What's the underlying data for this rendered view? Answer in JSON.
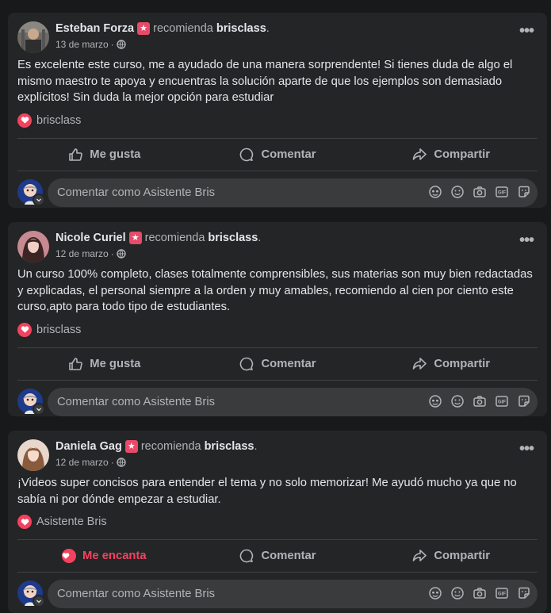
{
  "posts": [
    {
      "author": "Esteban Forza",
      "recommends": "recomienda",
      "page": "brisclass",
      "end": ".",
      "date": "13 de marzo",
      "sep": "·",
      "text": "Es excelente este curso, me a ayudado de una manera sorprendente! Si tienes duda de algo el mismo maestro te apoya y encuentras la solución aparte de que los ejemplos son demasiado explícitos! Sin duda la mejor opción para estudiar",
      "tag": "brisclass",
      "like_label": "Me gusta",
      "comment_label": "Comentar",
      "share_label": "Compartir",
      "comment_placeholder": "Comentar como Asistente Bris"
    },
    {
      "author": "Nicole Curiel",
      "recommends": "recomienda",
      "page": "brisclass",
      "end": ".",
      "date": "12 de marzo",
      "sep": "·",
      "text": "Un curso 100% completo, clases totalmente comprensibles, sus materias son muy bien redactadas y explicadas, el personal siempre a la orden y muy amables, recomiendo al cien por ciento este curso,apto para todo tipo de estudiantes.",
      "tag": "brisclass",
      "like_label": "Me gusta",
      "comment_label": "Comentar",
      "share_label": "Compartir",
      "comment_placeholder": "Comentar como Asistente Bris"
    },
    {
      "author": "Daniela Gag",
      "recommends": "recomienda",
      "page": "brisclass",
      "end": ".",
      "date": "12 de marzo",
      "sep": "·",
      "text": "¡Videos super concisos para entender el tema y no solo memorizar! Me ayudó mucho ya que no sabía ni por dónde empezar a estudiar.",
      "tag": "Asistente Bris",
      "like_label": "Me encanta",
      "comment_label": "Comentar",
      "share_label": "Compartir",
      "comment_placeholder": "Comentar como Asistente Bris"
    }
  ],
  "colors": {
    "background": "#18191a",
    "card": "#242526",
    "text": "#e4e6eb",
    "secondary": "#b0b3b8",
    "love": "#f3425f",
    "badge": "#e84a6a"
  },
  "icons": [
    "more-options-icon",
    "globe-icon",
    "heart-icon",
    "thumbs-up-icon",
    "comment-icon",
    "share-icon",
    "avatar-sticker-icon",
    "emoji-icon",
    "camera-icon",
    "gif-icon",
    "sticker-icon",
    "star-badge-icon"
  ]
}
